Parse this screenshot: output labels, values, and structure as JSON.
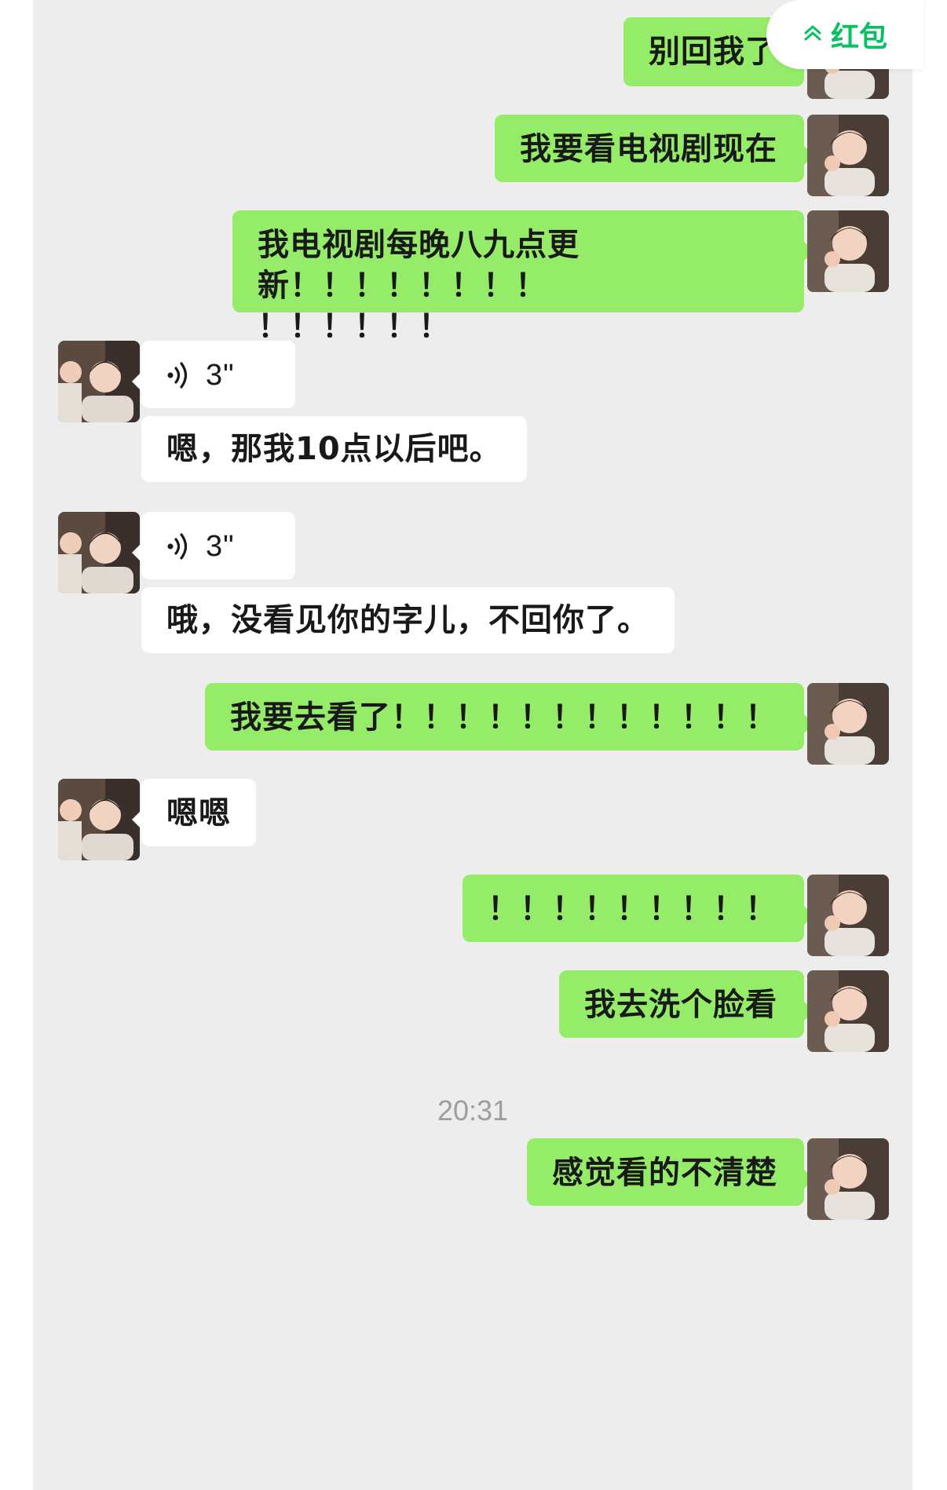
{
  "red_packet": {
    "label": "红包",
    "icon": "double-chevron-up-icon",
    "accent": "#07c160"
  },
  "colors": {
    "outgoing_bubble": "#95ec69",
    "incoming_bubble": "#ffffff",
    "chat_background": "#ededed",
    "timestamp_text": "#9e9e9e"
  },
  "messages": [
    {
      "direction": "out",
      "type": "text",
      "text": "别回我了"
    },
    {
      "direction": "out",
      "type": "text",
      "text": "我要看电视剧现在"
    },
    {
      "direction": "out",
      "type": "text",
      "line1": "我电视剧每晚八九点更新！！！！！！！！",
      "line2": "！！！！！！"
    },
    {
      "direction": "in",
      "type": "voice",
      "duration": "3\"",
      "icon": "voice-wave-icon"
    },
    {
      "direction": "in",
      "type": "text",
      "text": "嗯，那我10点以后吧。"
    },
    {
      "direction": "in",
      "type": "voice",
      "duration": "3\"",
      "icon": "voice-wave-icon"
    },
    {
      "direction": "in",
      "type": "text",
      "text": "哦，没看见你的字儿，不回你了。"
    },
    {
      "direction": "out",
      "type": "text",
      "text": "我要去看了！！！！！！！！！！！！"
    },
    {
      "direction": "in",
      "type": "text",
      "text": "嗯嗯"
    },
    {
      "direction": "out",
      "type": "text",
      "text": "！！！！！！！！！"
    },
    {
      "direction": "out",
      "type": "text",
      "text": "我去洗个脸看"
    },
    {
      "direction": "out",
      "type": "text",
      "text": "感觉看的不清楚"
    }
  ],
  "timestamp": "20:31"
}
